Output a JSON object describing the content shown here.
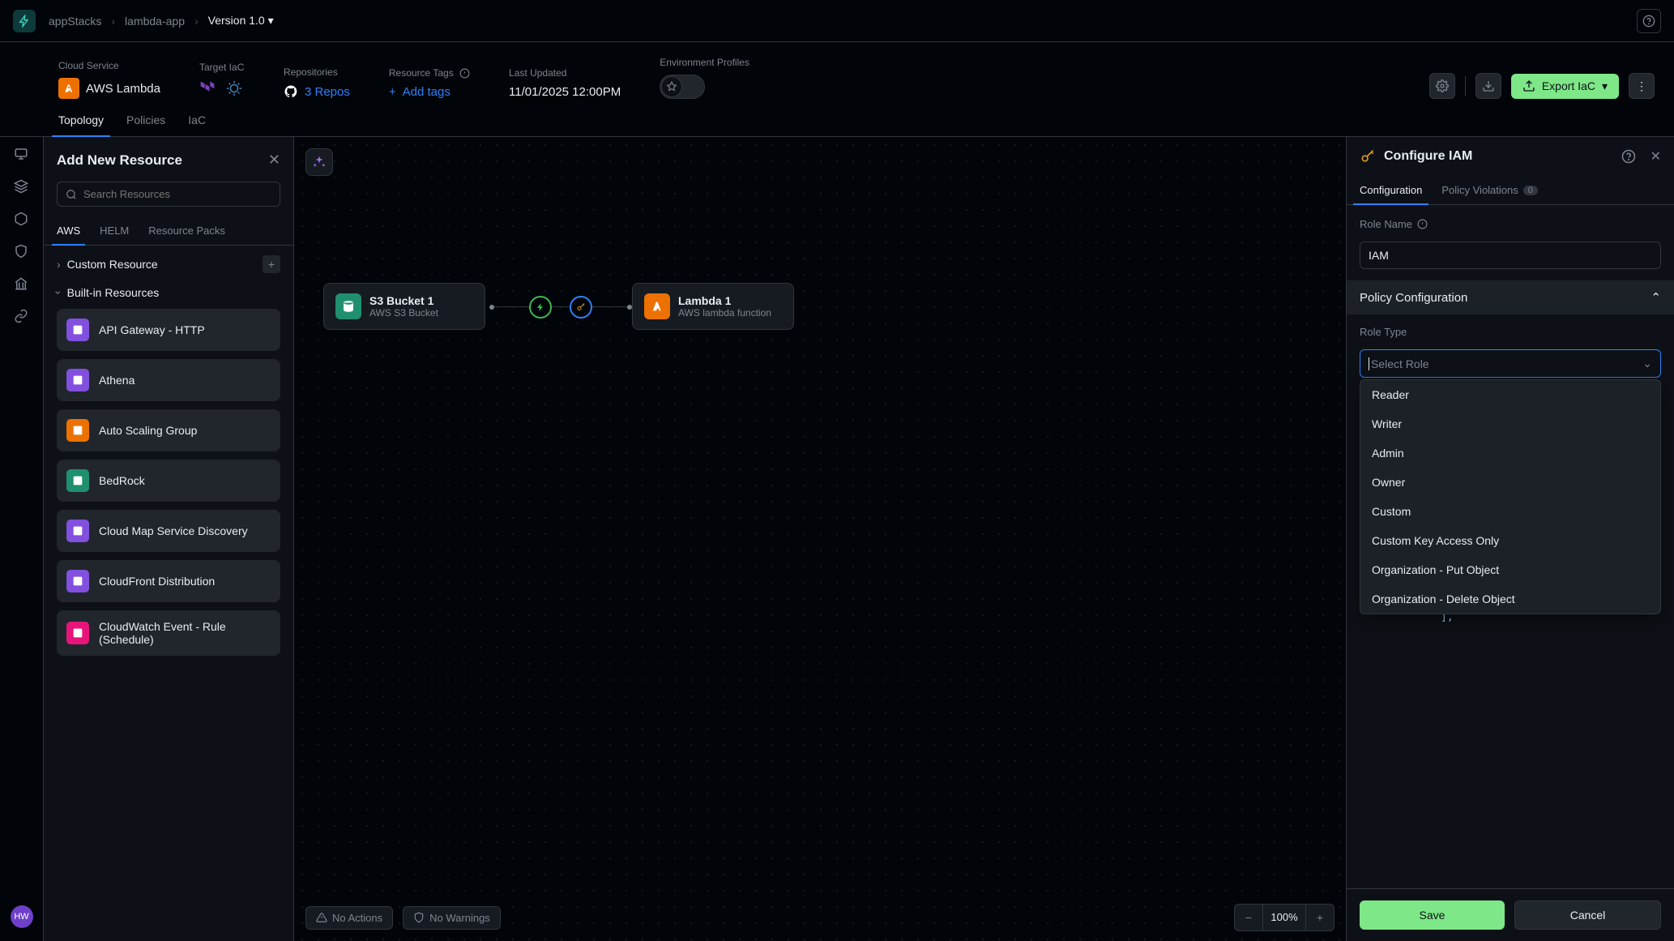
{
  "breadcrumb": {
    "root": "appStacks",
    "app": "lambda-app",
    "version": "Version 1.0"
  },
  "meta": {
    "cloud_service_label": "Cloud Service",
    "cloud_service_value": "AWS Lambda",
    "target_iac_label": "Target IaC",
    "repos_label": "Repositories",
    "repos_value": "3 Repos",
    "tags_label": "Resource Tags",
    "tags_add": "Add tags",
    "updated_label": "Last Updated",
    "updated_value": "11/01/2025 12:00PM",
    "env_label": "Environment Profiles"
  },
  "export_label": "Export IaC",
  "main_tabs": [
    "Topology",
    "Policies",
    "IaC"
  ],
  "resource_panel": {
    "title": "Add New Resource",
    "search_placeholder": "Search Resources",
    "tabs": [
      "AWS",
      "HELM",
      "Resource Packs"
    ],
    "custom_section": "Custom Resource",
    "builtin_section": "Built-in Resources",
    "items": [
      {
        "label": "API Gateway - HTTP",
        "color": "#8250df"
      },
      {
        "label": "Athena",
        "color": "#8250df"
      },
      {
        "label": "Auto Scaling Group",
        "color": "#ed7100"
      },
      {
        "label": "BedRock",
        "color": "#1f8f6f"
      },
      {
        "label": "Cloud Map Service Discovery",
        "color": "#8250df"
      },
      {
        "label": "CloudFront Distribution",
        "color": "#8250df"
      },
      {
        "label": "CloudWatch Event - Rule (Schedule)",
        "color": "#e7157b"
      }
    ]
  },
  "canvas": {
    "node1": {
      "title": "S3 Bucket 1",
      "sub": "AWS S3 Bucket"
    },
    "node2": {
      "title": "Lambda 1",
      "sub": "AWS lambda function"
    }
  },
  "bottom": {
    "no_actions": "No Actions",
    "no_warnings": "No Warnings",
    "zoom": "100%"
  },
  "config": {
    "title": "Configure IAM",
    "tabs": {
      "config": "Configuration",
      "violations": "Policy Violations",
      "violations_count": "0"
    },
    "role_name_label": "Role Name",
    "role_name_value": "IAM",
    "policy_section": "Policy Configuration",
    "role_type_label": "Role Type",
    "role_type_placeholder": "Select Role",
    "dropdown": [
      "Reader",
      "Writer",
      "Admin",
      "Owner",
      "Custom",
      "Custom Key Access Only",
      "Organization - Put Object",
      "Organization - Delete Object"
    ],
    "code_glimpse": "],",
    "save": "Save",
    "cancel": "Cancel"
  },
  "avatar": "HW"
}
